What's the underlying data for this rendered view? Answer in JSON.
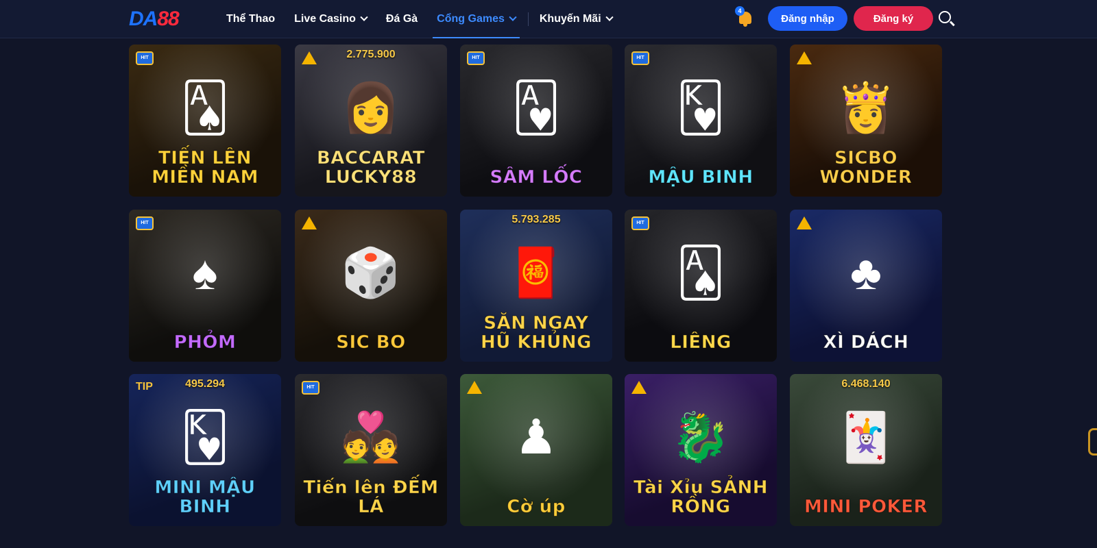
{
  "header": {
    "logo_a": "DA",
    "logo_b": "88",
    "nav": [
      {
        "label": "Thể Thao",
        "dropdown": false,
        "active": false
      },
      {
        "label": "Live Casino",
        "dropdown": true,
        "active": false
      },
      {
        "label": "Đá Gà",
        "dropdown": false,
        "active": false
      },
      {
        "label": "Cổng Games",
        "dropdown": true,
        "active": true
      },
      {
        "label": "Khuyến Mãi",
        "dropdown": true,
        "active": false
      }
    ],
    "notification_count": "4",
    "login_label": "Đăng nhập",
    "register_label": "Đăng ký"
  },
  "colors": {
    "background": "#111528",
    "header_bg": "#131a33",
    "accent_blue": "#1e5ef5",
    "accent_red": "#e0264d",
    "jackpot_gold": "#f7c948"
  },
  "games": [
    {
      "title": "TIẾN LÊN MIỀN NAM",
      "jackpot": "",
      "badge": "hit",
      "icon": "cards-coin-icon",
      "bg": "linear-gradient(160deg,#3a2a12,#1a1208 70%)",
      "title_color": "#ffd23a"
    },
    {
      "title": "BACCARAT LUCKY88",
      "jackpot": "2.775.900",
      "badge": "tri",
      "icon": "dealer-woman-icon",
      "bg": "linear-gradient(160deg,#3b3a44,#16161c 70%)",
      "title_color": "#ffe27a"
    },
    {
      "title": "SÂM LỐC",
      "jackpot": "",
      "badge": "hit",
      "icon": "aces-chips-icon",
      "bg": "linear-gradient(160deg,#2a2a2e,#0e0e12 70%)",
      "title_color": "#d67cff"
    },
    {
      "title": "MẬU BINH",
      "jackpot": "",
      "badge": "hit",
      "icon": "cards-chip-icon",
      "bg": "linear-gradient(160deg,#2b2b30,#101014 70%)",
      "title_color": "#5fe6ff"
    },
    {
      "title": "SICBO WONDER",
      "jackpot": "",
      "badge": "tri",
      "icon": "wonder-woman-icon",
      "bg": "linear-gradient(160deg,#4a2a10,#1c0f06 70%)",
      "title_color": "#ffcf4a"
    },
    {
      "title": "PHỎM",
      "jackpot": "",
      "badge": "hit",
      "icon": "spade-coin-icon",
      "bg": "linear-gradient(160deg,#2e2a24,#0f0e0c 70%)",
      "title_color": "#c46bff"
    },
    {
      "title": "SIC BO",
      "jackpot": "",
      "badge": "tri",
      "icon": "dice-icon",
      "bg": "linear-gradient(160deg,#3a2a1a,#151009 70%)",
      "title_color": "#ffc93a"
    },
    {
      "title": "SĂN NGAY HŨ KHỦNG",
      "jackpot": "5.793.285",
      "badge": "",
      "icon": "fortune-god-icon",
      "bg": "linear-gradient(160deg,#1f2f5a,#111a36 70%)",
      "title_color": "#ffd54a"
    },
    {
      "title": "LIÊNG",
      "jackpot": "",
      "badge": "hit",
      "icon": "aces-chip-icon",
      "bg": "linear-gradient(160deg,#26262a,#0c0c10 60%)",
      "title_color": "#ffd84a"
    },
    {
      "title": "XÌ DÁCH",
      "jackpot": "",
      "badge": "tri",
      "icon": "spade-club-icon",
      "bg": "linear-gradient(160deg,#1a2a66,#0d1236 70%)",
      "title_color": "#ffffff"
    },
    {
      "title": "MINI MẬU BINH",
      "jackpot": "495.294",
      "badge": "tip",
      "icon": "card-hand-icon",
      "bg": "linear-gradient(160deg,#16255a,#0b1230 70%)",
      "title_color": "#5fd0ff"
    },
    {
      "title": "Tiến lên ĐẾM LÁ",
      "jackpot": "",
      "badge": "hit",
      "icon": "couple-icon",
      "bg": "linear-gradient(160deg,#2a2a2e,#0e0e10 70%)",
      "title_color": "#ffd54a"
    },
    {
      "title": "Cờ úp",
      "jackpot": "",
      "badge": "tri",
      "icon": "chess-piece-icon",
      "bg": "linear-gradient(160deg,#3d5a3a,#1c2a1a 70%)",
      "title_color": "#ffcf3a"
    },
    {
      "title": "Tài Xỉu SẢNH RỒNG",
      "jackpot": "",
      "badge": "tri",
      "icon": "dragon-cup-icon",
      "bg": "linear-gradient(160deg,#3a1f66,#170c30 70%)",
      "title_color": "#ffd54a"
    },
    {
      "title": "MINI POKER",
      "jackpot": "6.468.140",
      "badge": "",
      "icon": "poker-machine-icon",
      "bg": "linear-gradient(160deg,#3a4a3a,#1a221a 70%)",
      "title_color": "#ff5a3a"
    }
  ],
  "icon_glyphs": {
    "cards-coin-icon": "🂡",
    "dealer-woman-icon": "👩",
    "aces-chips-icon": "🂱",
    "cards-chip-icon": "🂾",
    "wonder-woman-icon": "👸",
    "spade-coin-icon": "♠",
    "dice-icon": "🎲",
    "fortune-god-icon": "🧧",
    "aces-chip-icon": "🂡",
    "spade-club-icon": "♣",
    "card-hand-icon": "🂾",
    "couple-icon": "💑",
    "chess-piece-icon": "♟",
    "dragon-cup-icon": "🐉",
    "poker-machine-icon": "🃏"
  }
}
